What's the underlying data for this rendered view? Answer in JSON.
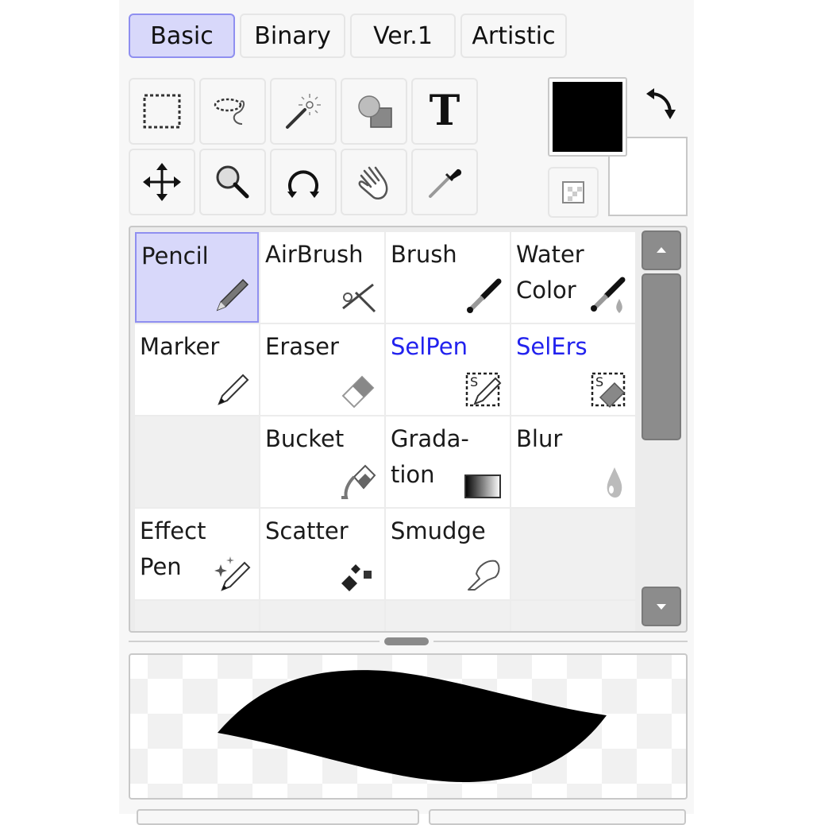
{
  "tabs": [
    {
      "label": "Basic",
      "active": true
    },
    {
      "label": "Binary",
      "active": false
    },
    {
      "label": "Ver.1",
      "active": false
    },
    {
      "label": "Artistic",
      "active": false
    }
  ],
  "tools": [
    {
      "name": "rectangle-select",
      "icon": "rect-select-icon"
    },
    {
      "name": "lasso",
      "icon": "lasso-icon"
    },
    {
      "name": "magic-wand",
      "icon": "magic-wand-icon"
    },
    {
      "name": "shapes",
      "icon": "shapes-icon"
    },
    {
      "name": "text",
      "icon": "text-icon",
      "glyph": "T"
    },
    {
      "name": "move",
      "icon": "move-icon"
    },
    {
      "name": "zoom",
      "icon": "zoom-icon"
    },
    {
      "name": "rotate",
      "icon": "rotate-icon"
    },
    {
      "name": "hand",
      "icon": "hand-icon"
    },
    {
      "name": "eyedropper",
      "icon": "eyedropper-icon"
    }
  ],
  "colors": {
    "foreground": "#000000",
    "background": "#ffffff",
    "accent": "#8f8ff0",
    "accent_fill": "#d8d8fa",
    "selection_tool_text": "#2222ee"
  },
  "brushes": [
    {
      "label": "Pencil",
      "icon": "pencil-icon",
      "selected": true
    },
    {
      "label": "AirBrush",
      "icon": "airbrush-icon"
    },
    {
      "label": "Brush",
      "icon": "brush-icon"
    },
    {
      "label": "Water\nColor",
      "icon": "watercolor-icon"
    },
    {
      "label": "Marker",
      "icon": "marker-icon"
    },
    {
      "label": "Eraser",
      "icon": "eraser-icon"
    },
    {
      "label": "SelPen",
      "icon": "selpen-icon",
      "blue": true
    },
    {
      "label": "SelErs",
      "icon": "selers-icon",
      "blue": true
    },
    {
      "label": "",
      "icon": "",
      "empty": true
    },
    {
      "label": "Bucket",
      "icon": "bucket-icon"
    },
    {
      "label": "Grada-\ntion",
      "icon": "gradation-icon"
    },
    {
      "label": "Blur",
      "icon": "blur-icon"
    },
    {
      "label": "Effect\nPen",
      "icon": "effect-pen-icon"
    },
    {
      "label": "Scatter",
      "icon": "scatter-icon"
    },
    {
      "label": "Smudge",
      "icon": "smudge-icon"
    },
    {
      "label": "",
      "icon": "",
      "empty": true
    }
  ]
}
